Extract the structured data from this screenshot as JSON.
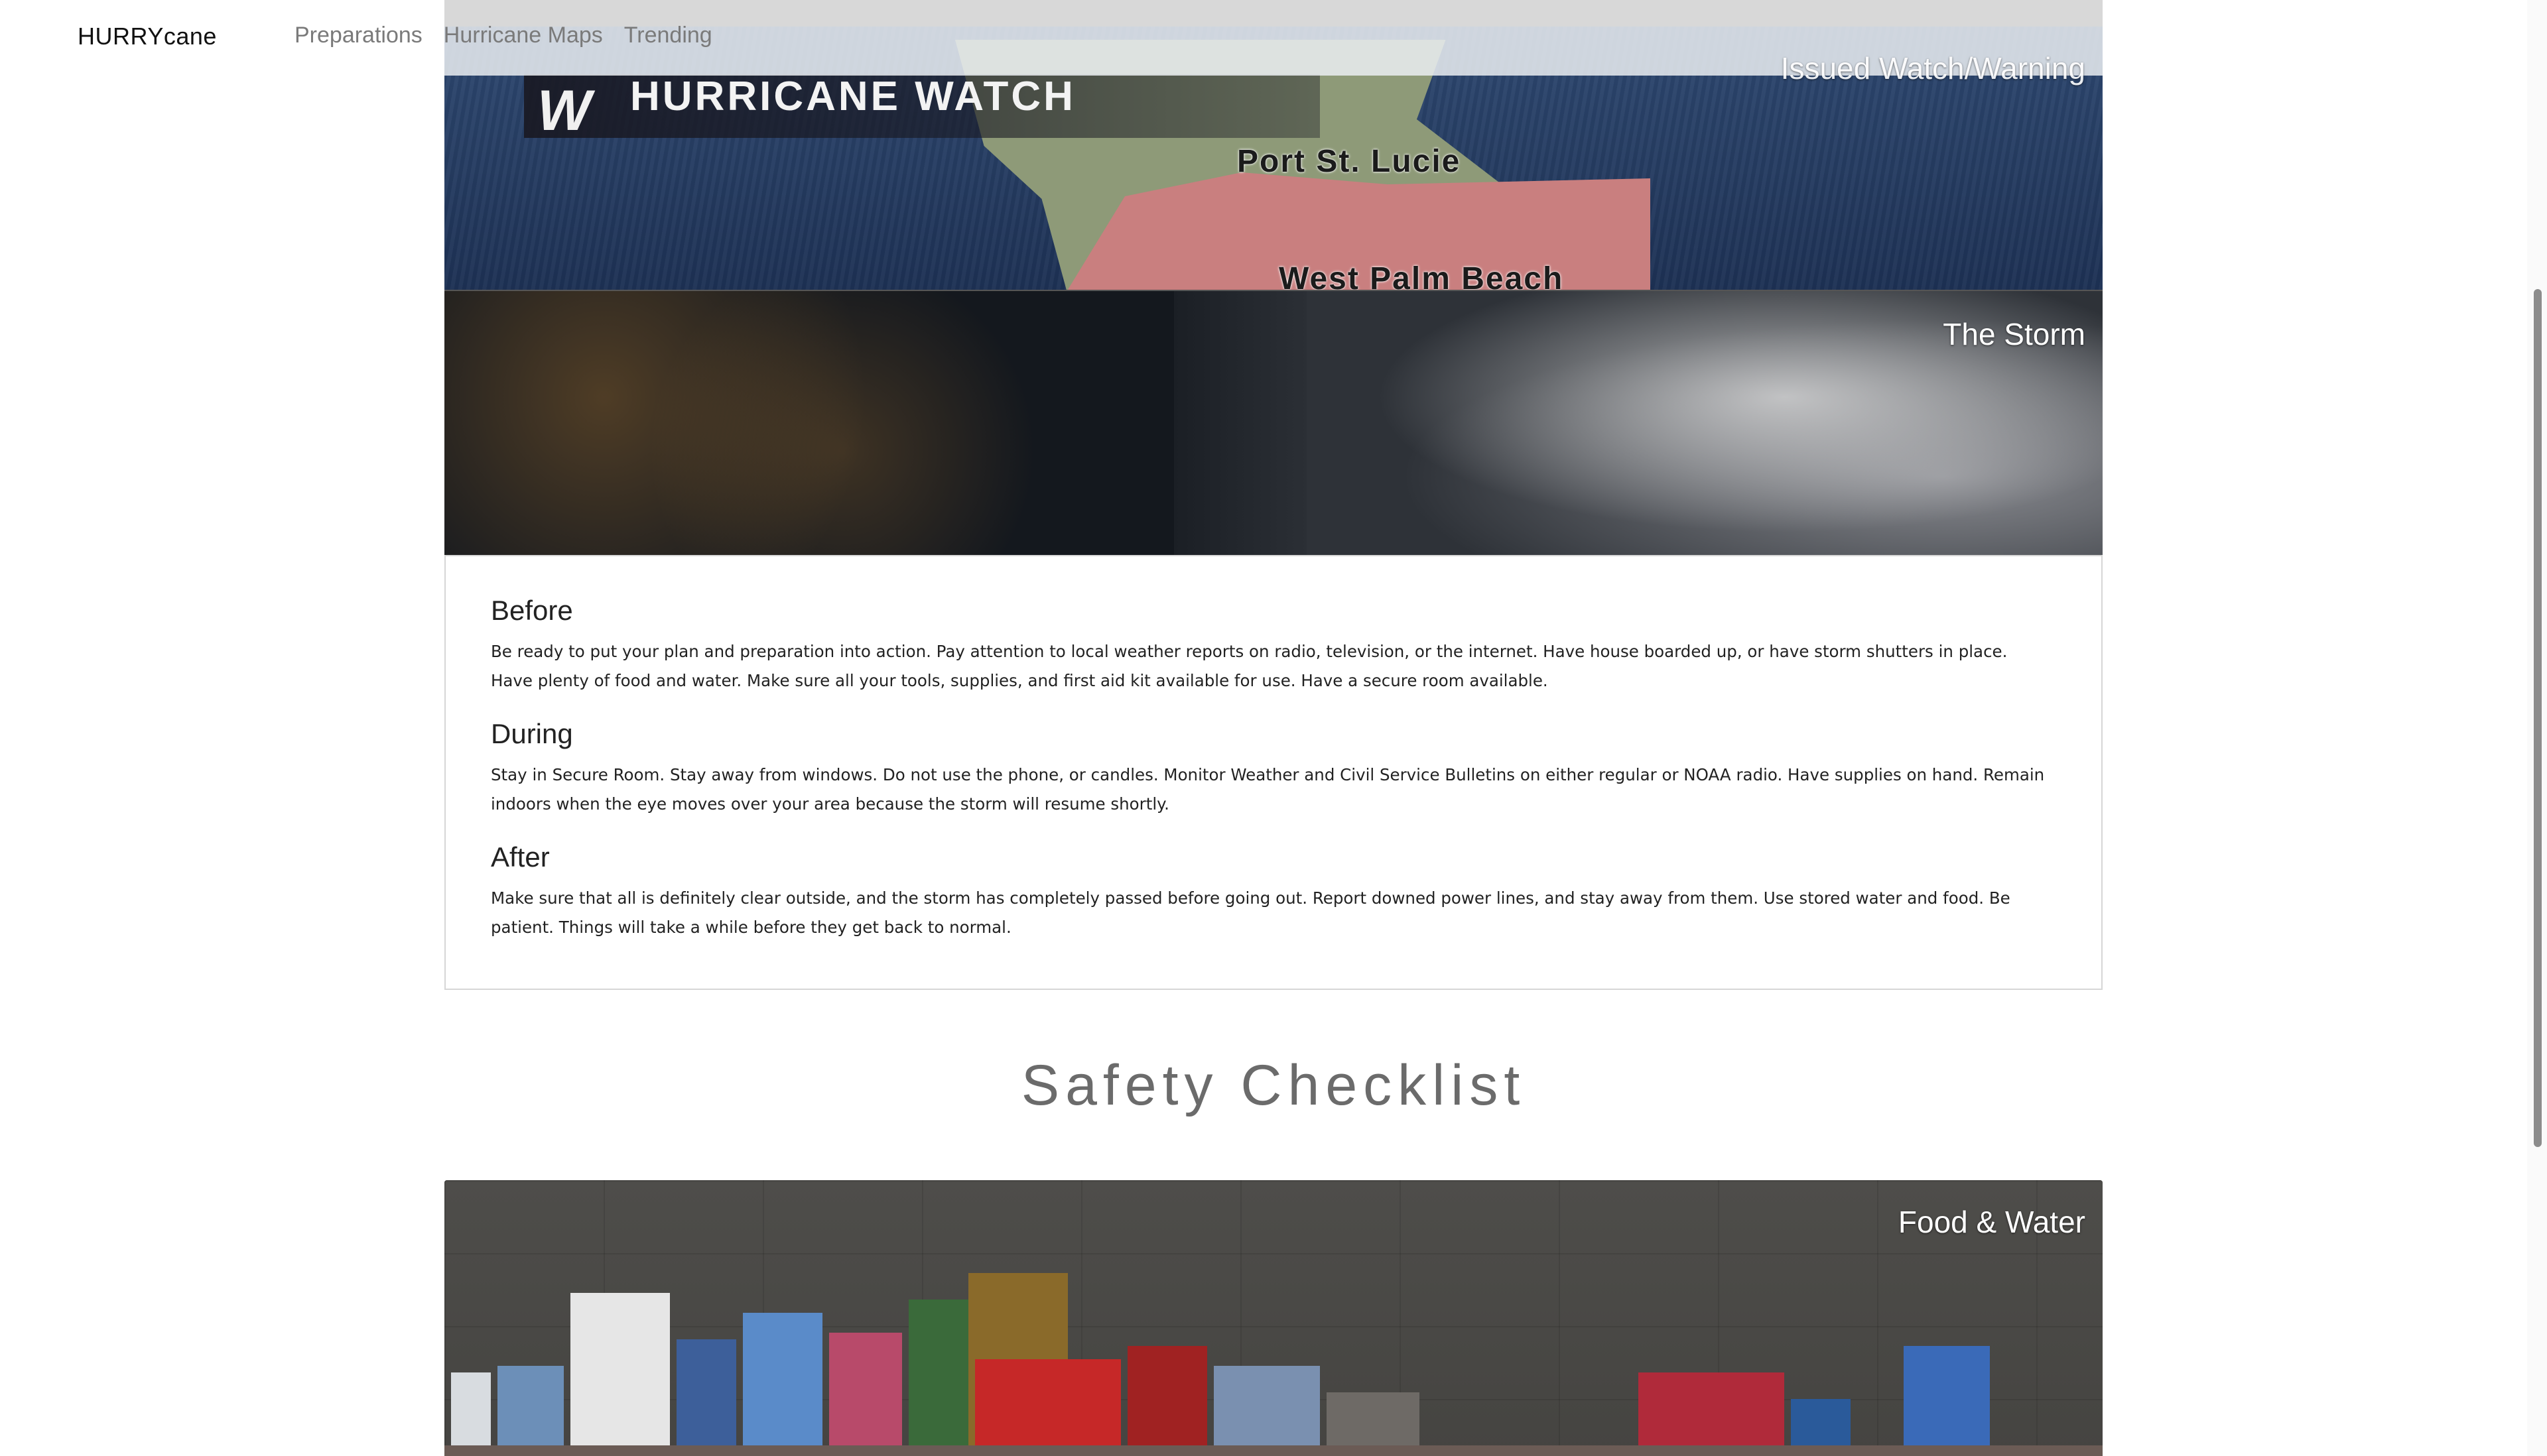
{
  "navbar": {
    "brand": "HURRYcane",
    "links": [
      "Preparations",
      "Hurricane Maps",
      "Trending"
    ]
  },
  "banners": {
    "watch": {
      "caption": "Issued Watch/Warning",
      "map_title": "HURRICANE WATCH",
      "logo": "W",
      "cities": [
        "Port St. Lucie",
        "West Palm Beach"
      ]
    },
    "storm": {
      "caption": "The Storm"
    },
    "food": {
      "caption": "Food & Water"
    }
  },
  "info": {
    "before": {
      "heading": "Before",
      "text": "Be ready to put your plan and preparation into action. Pay attention to local weather reports on radio, television, or the internet. Have house boarded up, or have storm shutters in place. Have plenty of food and water. Make sure all your tools, supplies, and first aid kit available for use. Have a secure room available."
    },
    "during": {
      "heading": "During",
      "text": "Stay in Secure Room. Stay away from windows. Do not use the phone, or candles. Monitor Weather and Civil Service Bulletins on either regular or NOAA radio. Have supplies on hand. Remain indoors when the eye moves over your area because the storm will resume shortly."
    },
    "after": {
      "heading": "After",
      "text": "Make sure that all is definitely clear outside, and the storm has completely passed before going out. Report downed power lines, and stay away from them. Use stored water and food. Be patient. Things will take a while before they get back to normal."
    }
  },
  "safety": {
    "title": "Safety Checklist"
  }
}
